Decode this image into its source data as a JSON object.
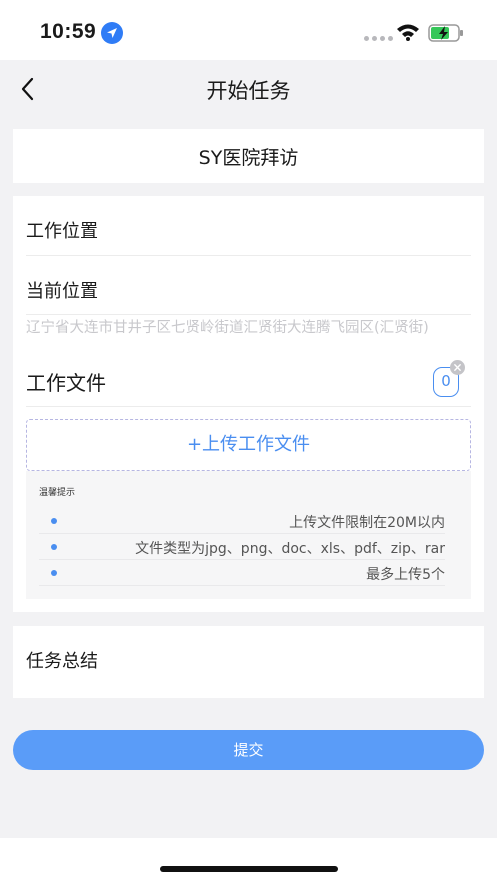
{
  "status_bar": {
    "time": "10:59"
  },
  "nav": {
    "title": "开始任务"
  },
  "task_name": "SY医院拜访",
  "form": {
    "work_location_label": "工作位置",
    "current_location_label": "当前位置",
    "current_address": "辽宁省大连市甘井子区七贤岭街道汇贤街大连腾飞园区(汇贤街)",
    "work_files_label": "工作文件",
    "file_count": "0",
    "upload_label": "+上传工作文件",
    "tips_title": "温馨提示",
    "tips": [
      "上传文件限制在20M以内",
      "文件类型为jpg、png、doc、xls、pdf、zip、rar",
      "最多上传5个"
    ],
    "summary_label": "任务总结"
  },
  "submit_label": "提交",
  "colors": {
    "accent": "#4a8ef0",
    "button": "#5a9cf8",
    "background": "#f2f2f4"
  }
}
